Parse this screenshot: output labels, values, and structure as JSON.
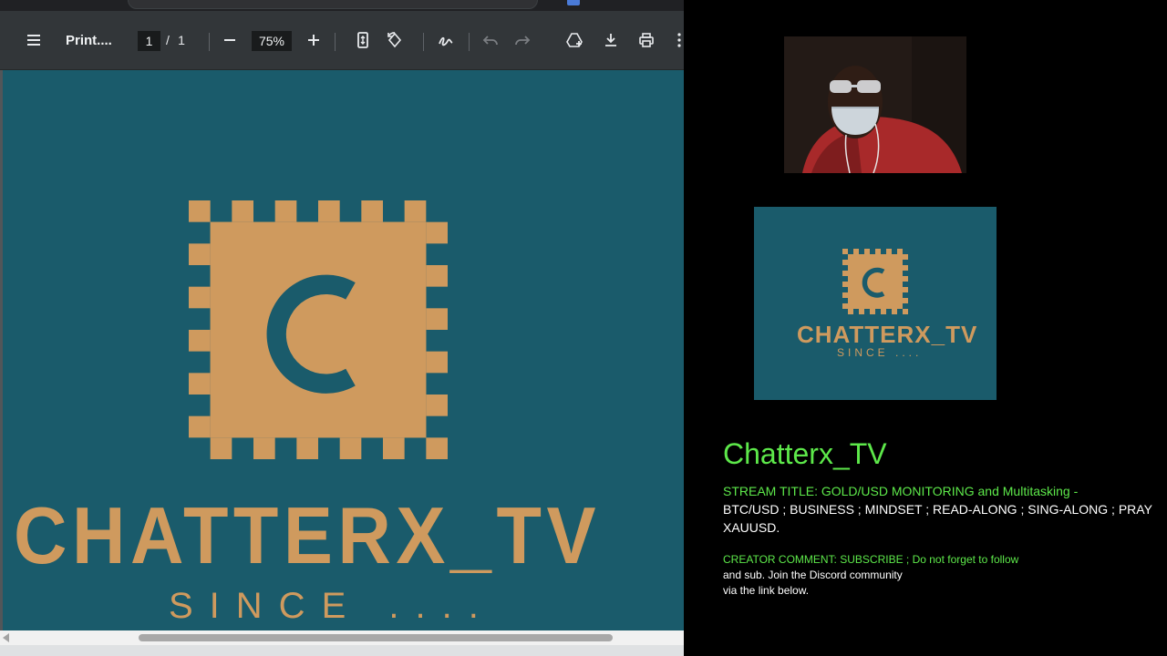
{
  "colors": {
    "pdf_toolbar": "#323639",
    "pdf_page_teal": "#1a5b6b",
    "logo_gold": "#cf9a5e",
    "overlay_green": "#5de84a",
    "overlay_white": "#ffffff"
  },
  "pdf_viewer": {
    "title": "Print....",
    "page_current": "1",
    "page_separator": "/",
    "page_total": "1",
    "zoom": "75%",
    "icons": [
      "menu-icon",
      "zoom-out-icon",
      "zoom-in-icon",
      "fit-page-icon",
      "rotate-icon",
      "annotate-pen-icon",
      "undo-icon",
      "redo-icon",
      "save-to-drive-icon",
      "download-icon",
      "print-icon",
      "more-icon"
    ]
  },
  "document": {
    "brand": "CHATTERX_TV",
    "since": "SINCE ....",
    "logo_letter": "C"
  },
  "thumbnail": {
    "brand": "CHATTERX_TV",
    "since": "SINCE ...."
  },
  "stream_info": {
    "channel_name": "Chatterx_TV",
    "title_line1": "STREAM TITLE: GOLD/USD MONITORING and Multitasking -",
    "title_line2": "BTC/USD ; BUSINESS ; MINDSET ; READ-ALONG ; SING-ALONG ; PRAY",
    "title_line3": "XAUUSD.",
    "comment_line1": "CREATOR COMMENT: SUBSCRIBE ; Do not forget to follow",
    "comment_line2": "and sub. Join the Discord community",
    "comment_line3": "via the link below."
  }
}
